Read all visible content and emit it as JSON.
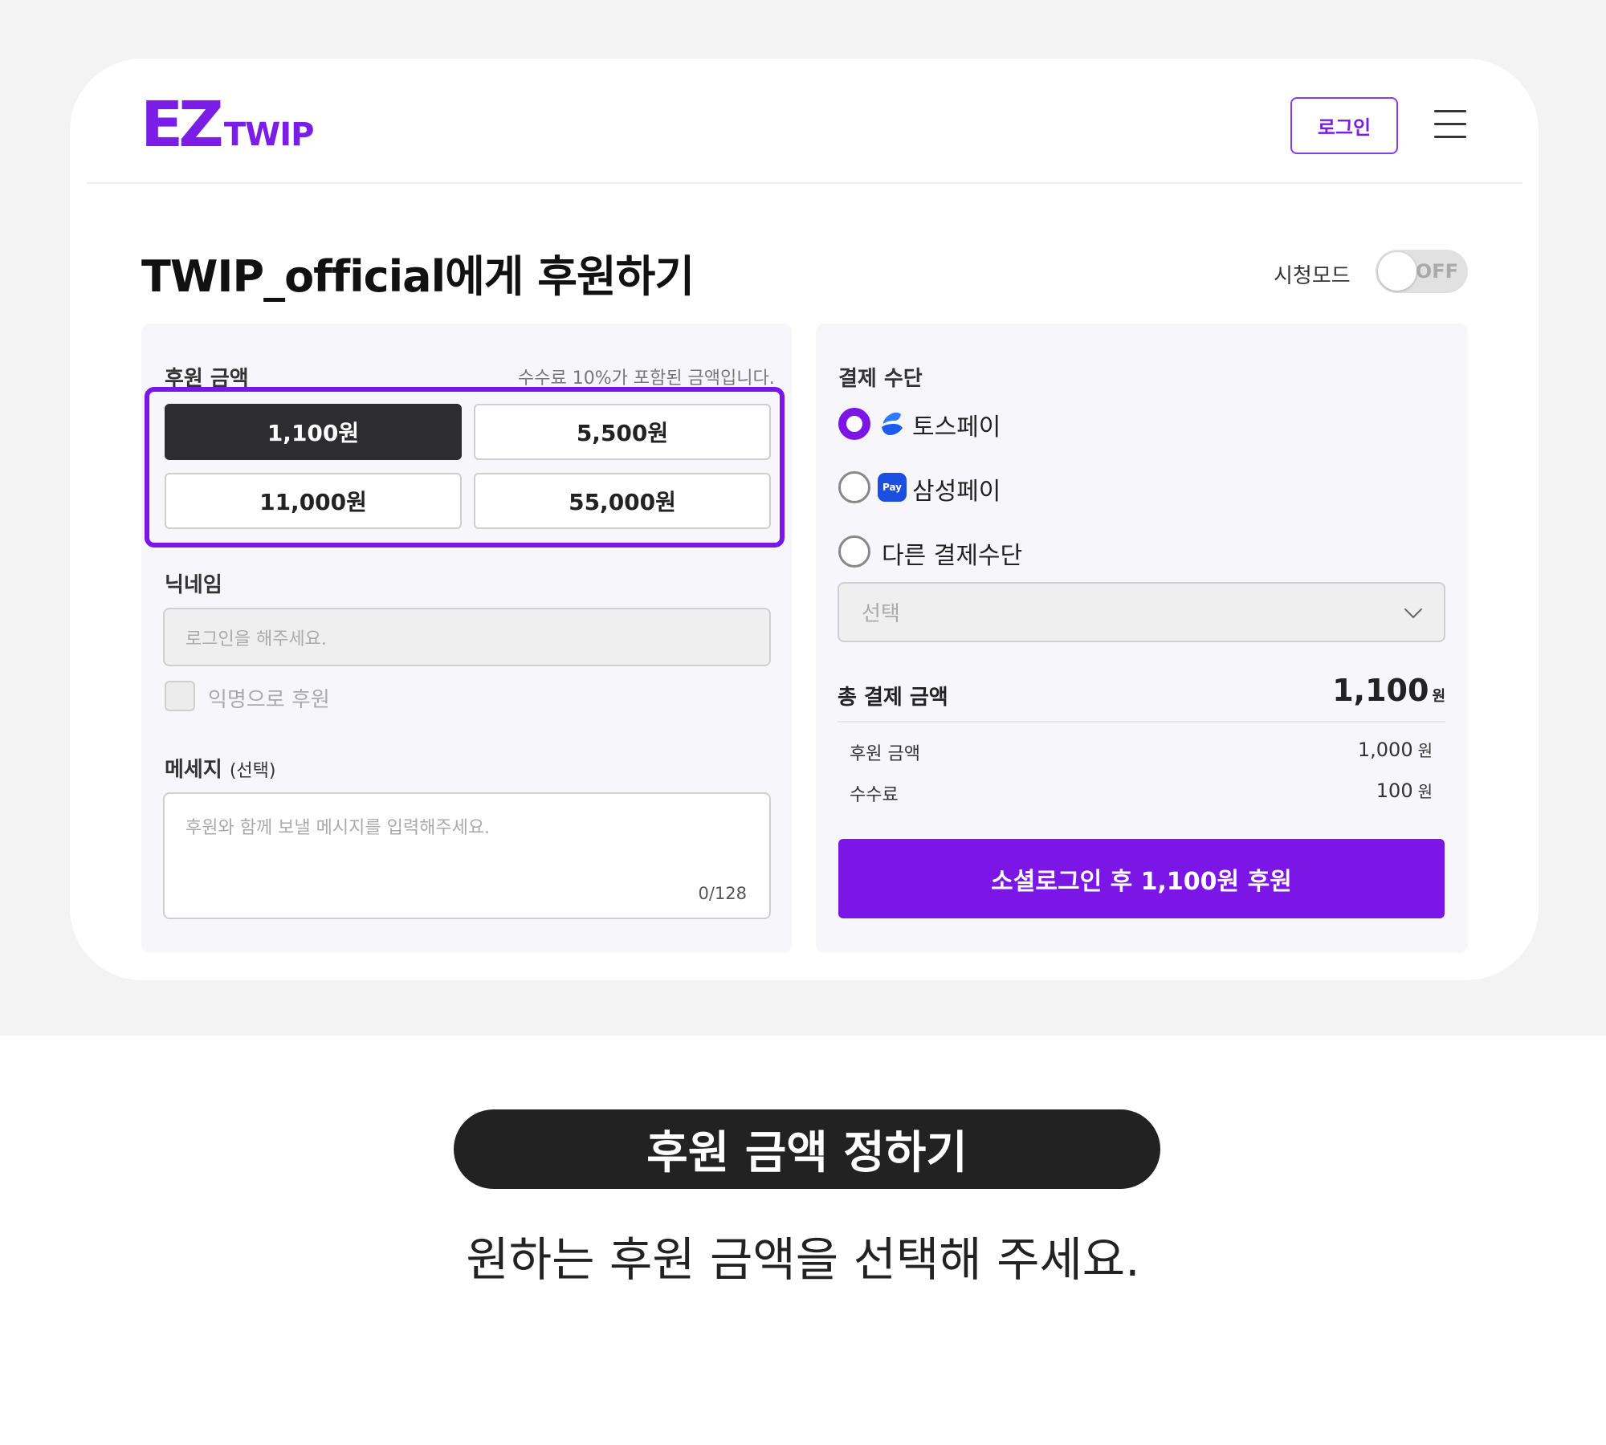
{
  "header": {
    "logo_main": "EZ",
    "logo_sub": "TWIP",
    "login_label": "로그인"
  },
  "title": {
    "text": "TWIP_official에게 후원하기",
    "mode_label": "시청모드",
    "toggle_state": "OFF"
  },
  "donation": {
    "amount_label": "후원 금액",
    "fee_note": "수수료 10%가 포함된 금액입니다.",
    "amounts": [
      "1,100원",
      "5,500원",
      "11,000원",
      "55,000원"
    ],
    "selected_amount": "1,100원",
    "nickname_label": "닉네임",
    "nickname_placeholder": "로그인을 해주세요.",
    "anonymous_label": "익명으로 후원",
    "message_label": "메세지",
    "message_optional": "(선택)",
    "message_placeholder": "후원와 함께 보낼 메시지를 입력해주세요.",
    "message_count": "0/128"
  },
  "payment": {
    "method_label": "결제 수단",
    "methods": [
      "토스페이",
      "삼성페이",
      "다른 결제수단"
    ],
    "selected_method": "토스페이",
    "samsung_icon_text": "Pay",
    "select_placeholder": "선택",
    "total_label": "총 결제 금액",
    "total_value": "1,100",
    "total_unit": "원",
    "donation_amount_label": "후원 금액",
    "donation_amount_value": "1,000",
    "fee_label": "수수료",
    "fee_value": "100",
    "unit": "원",
    "donate_button": "소셜로그인 후 1,100원 후원"
  },
  "caption": {
    "title": "후원 금액 정하기",
    "subtitle": "원하는 후원 금액을 선택해 주세요."
  },
  "colors": {
    "accent": "#7b16e6",
    "selected_dark": "#2d2d2f",
    "caption_pill": "#222222"
  },
  "icons": {
    "menu": "hamburger-menu-icon",
    "toss": "toss-icon",
    "samsung": "samsung-pay-icon",
    "dropdown": "chevron-down-icon"
  }
}
